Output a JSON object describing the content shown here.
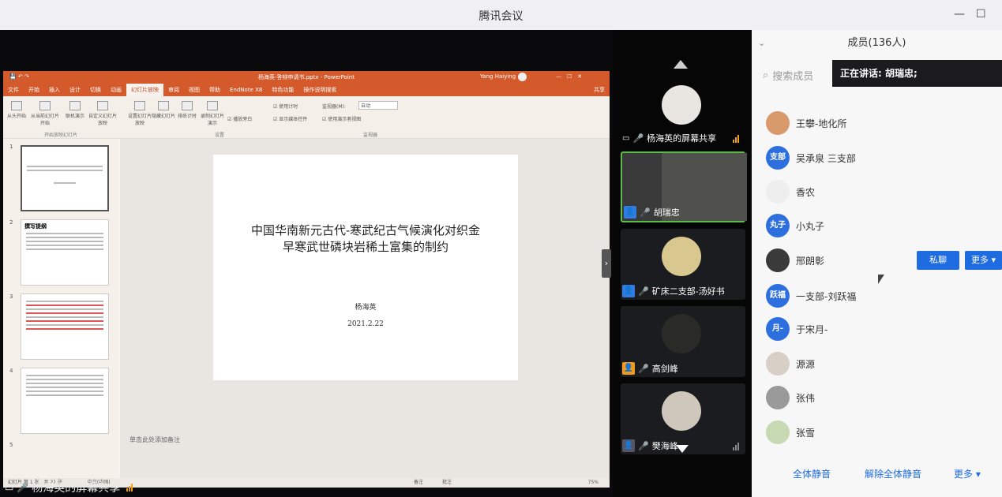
{
  "window": {
    "title": "腾讯会议",
    "minimize": "—",
    "maximize": "☐"
  },
  "share": {
    "label": "杨海英的屏幕共享",
    "ppt": {
      "title": "杨海英-答辩申请书.pptx - PowerPoint",
      "user": "Yang Haiying",
      "share_btn": "共享",
      "tabs": [
        "文件",
        "开始",
        "插入",
        "设计",
        "切换",
        "动画",
        "幻灯片放映",
        "审阅",
        "视图",
        "帮助",
        "EndNote X8",
        "特色功能",
        "操作说明搜索"
      ],
      "ribbon": {
        "buttons": [
          "从头开始",
          "从当前幻灯片开始",
          "联机演示",
          "自定义幻灯片放映",
          "设置幻灯片放映",
          "隐藏幻灯片",
          "排练计时",
          "录制幻灯片演示"
        ],
        "checks": [
          "使用计时",
          "播放旁白",
          "显示媒体控件",
          "使用演示者视图"
        ],
        "monitor_label": "监视器(M):",
        "monitor_value": "自动",
        "groups": [
          "开始放映幻灯片",
          "设置",
          "监视器"
        ]
      },
      "thumb_numbers": [
        "1",
        "2",
        "3",
        "4",
        "5"
      ],
      "thumb2_heading": "撰写提纲",
      "slide": {
        "title_line1": "中国华南新元古代-寒武纪古气候演化对织金",
        "title_line2": "早寒武世磷块岩稀土富集的制约",
        "author": "杨海英",
        "date": "2021.2.22"
      },
      "notes": "单击此处添加备注",
      "status": "幻灯片 第 1 张，共 21 张",
      "status_lang": "中文(中国)",
      "status_notes": "备注",
      "status_comments": "批注",
      "zoom": "75%"
    }
  },
  "videos": [
    {
      "name": "杨海英的屏幕共享",
      "muted": false
    },
    {
      "name": "胡瑞忠",
      "muted": false
    },
    {
      "name": "矿床二支部-汤好书",
      "muted": true
    },
    {
      "name": "高剑峰",
      "muted": true
    },
    {
      "name": "樊海峰",
      "muted": false
    }
  ],
  "panel": {
    "title": "成员(136人)",
    "search_placeholder": "搜索成员",
    "speaking": "正在讲话: 胡瑞忠;",
    "members": [
      {
        "name": "王攀-地化所",
        "avatar": ""
      },
      {
        "name": "吴承泉 三支部",
        "avatar": "支部"
      },
      {
        "name": "香农",
        "avatar": ""
      },
      {
        "name": "小丸子",
        "avatar": "丸子"
      },
      {
        "name": "邢朗彰",
        "avatar": ""
      },
      {
        "name": "一支部-刘跃福",
        "avatar": "跃福"
      },
      {
        "name": "于宋月-",
        "avatar": "月-"
      },
      {
        "name": "源源",
        "avatar": ""
      },
      {
        "name": "张伟",
        "avatar": ""
      },
      {
        "name": "张雪",
        "avatar": ""
      }
    ],
    "private_chat": "私聊",
    "more_btn": "更多",
    "mute_all": "全体静音",
    "unmute_all": "解除全体静音",
    "more": "更多"
  },
  "colors": {
    "accent": "#1f6be0",
    "ppt_orange": "#d45a2c",
    "active_green": "#5bbd48"
  }
}
